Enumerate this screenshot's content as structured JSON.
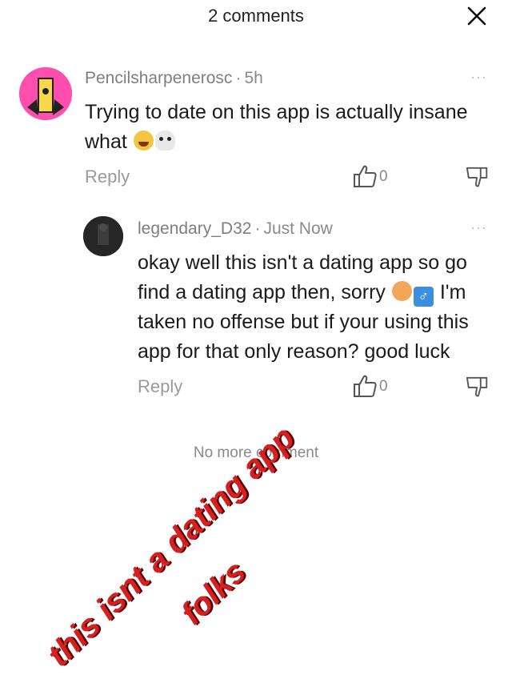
{
  "header": {
    "title": "2 comments",
    "close_icon": "close-icon"
  },
  "comments": [
    {
      "username": "Pencilsharpenerosc",
      "time": "5h",
      "text_line1": "Trying to date on this app is actually insane",
      "text_line2": "what",
      "emojis": [
        "loudly-crying-face",
        "skull"
      ],
      "reply_label": "Reply",
      "like_count": "0",
      "more": "···"
    },
    {
      "username": "legendary_D32",
      "time": "Just Now",
      "text_line1": "okay well this isn't a dating app so go",
      "text_line2_a": "find a dating app then, sorry",
      "text_line2_b": "I'm",
      "text_line3": "taken no offense but if your using this",
      "text_line4": "app for that only reason? good luck",
      "emojis": [
        "person-shrugging",
        "male-sign"
      ],
      "male_glyph": "♂",
      "reply_label": "Reply",
      "like_count": "0",
      "more": "···"
    }
  ],
  "footer": {
    "no_more": "No more comment"
  },
  "overlay": {
    "line1": "this isnt a dating app",
    "line2": "folks",
    "color": "#d42020"
  },
  "colors": {
    "meta": "#8a8a8a",
    "text": "#1a1a1a",
    "background": "#ffffff"
  }
}
